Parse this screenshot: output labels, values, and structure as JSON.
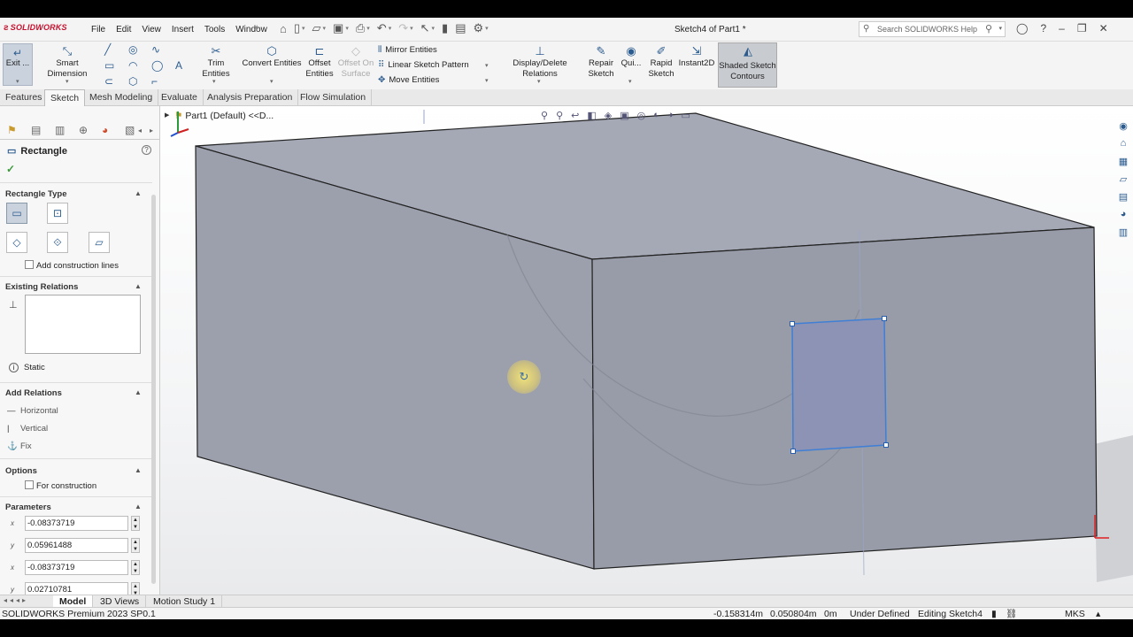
{
  "app": {
    "logo_text": "SOLIDWORKS",
    "document_title": "Sketch4 of Part1 *",
    "search_placeholder": "Search SOLIDWORKS Help"
  },
  "menu": [
    "File",
    "Edit",
    "View",
    "Insert",
    "Tools",
    "Window"
  ],
  "ribbon": {
    "exit_label": "Exit ...",
    "smart_dimension": "Smart Dimension",
    "trim_entities": "Trim Entities",
    "convert_entities": "Convert Entities",
    "offset_entities_1": "Offset",
    "offset_entities_2": "Entities",
    "offset_surface_1": "Offset On",
    "offset_surface_2": "Surface",
    "mirror_entities": "Mirror Entities",
    "linear_pattern": "Linear Sketch Pattern",
    "move_entities": "Move Entities",
    "display_relations": "Display/Delete Relations",
    "repair_sketch_1": "Repair",
    "repair_sketch_2": "Sketch",
    "quick_snaps": "Qui...",
    "rapid_sketch_1": "Rapid",
    "rapid_sketch_2": "Sketch",
    "instant2d": "Instant2D",
    "shaded_contours_1": "Shaded Sketch",
    "shaded_contours_2": "Contours"
  },
  "tabs": [
    {
      "label": "Features"
    },
    {
      "label": "Sketch",
      "active": true
    },
    {
      "label": "Mesh Modeling"
    },
    {
      "label": "Evaluate"
    },
    {
      "label": "Analysis Preparation"
    },
    {
      "label": "Flow Simulation"
    }
  ],
  "property_manager": {
    "title": "Rectangle",
    "rectangle_type": "Rectangle Type",
    "add_construction_lines": "Add construction lines",
    "existing_relations": "Existing Relations",
    "status": "Static",
    "add_relations": "Add Relations",
    "relations": [
      "Horizontal",
      "Vertical",
      "Fix"
    ],
    "options": "Options",
    "for_construction": "For construction",
    "parameters": "Parameters",
    "param_values": [
      "-0.08373719",
      "0.05961488",
      "-0.08373719",
      "0.02710781"
    ],
    "param_labels": [
      "x",
      "y",
      "x",
      "y"
    ]
  },
  "viewport": {
    "tree_node": "Part1 (Default) <<D..."
  },
  "bottom_tabs": [
    {
      "label": "Model",
      "active": true
    },
    {
      "label": "3D Views"
    },
    {
      "label": "Motion Study 1"
    }
  ],
  "status_bar": {
    "product": "SOLIDWORKS Premium 2023 SP0.1",
    "x": "-0.158314m",
    "y": "0.050804m",
    "z": "0m",
    "state": "Under Defined",
    "editing": "Editing Sketch4",
    "units": "MKS"
  },
  "colors": {
    "accent": "#2c5c8f",
    "box_face": "#9ea3b0",
    "sketch_fill": "#8c93b4",
    "sketch_line": "#3f7fd6"
  }
}
